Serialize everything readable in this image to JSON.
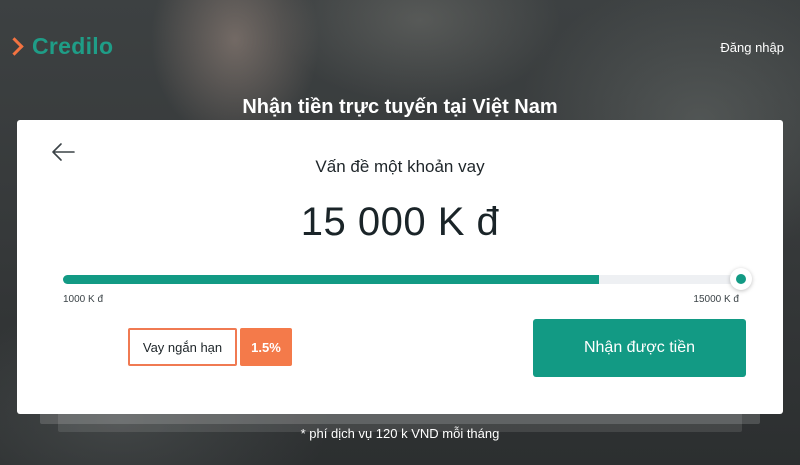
{
  "header": {
    "logo_text": "Credilo",
    "login_label": "Đăng nhập"
  },
  "hero": {
    "title": "Nhận tiền trực tuyến tại Việt Nam"
  },
  "loan_card": {
    "title": "Vấn đề một khoản vay",
    "amount_display": "15 000 K đ",
    "slider": {
      "min_label": "1000 K đ",
      "max_label": "15000 K đ",
      "min_value": 1000,
      "max_value": 15000,
      "value": 15000,
      "fill_fraction": 0.79
    },
    "term_label": "Vay ngắn hạn",
    "rate_label": "1.5%",
    "cta_label": "Nhận được tiền"
  },
  "footnote": "* phí dịch vụ 120 k VND mỗi tháng",
  "colors": {
    "brand_green": "#129a84",
    "accent_orange": "#f47a4a",
    "text_dark": "#1e2529"
  },
  "icons": {
    "logo_mark": "chevron-right-icon",
    "back": "arrow-left-icon"
  }
}
